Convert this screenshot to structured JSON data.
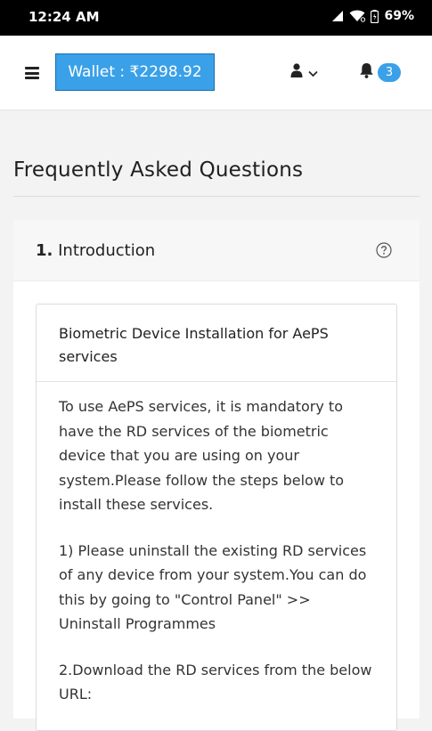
{
  "status_bar": {
    "time": "12:24 AM",
    "battery": "69%"
  },
  "navbar": {
    "wallet_label": "Wallet : ₹2298.92",
    "notification_count": "3"
  },
  "page": {
    "title": "Frequently Asked Questions"
  },
  "accordion": {
    "number": "1.",
    "title": "Introduction"
  },
  "card": {
    "heading": "Biometric Device Installation for AePS services",
    "paragraphs": [
      "To use AePS services, it is mandatory to have the RD services of the biometric device that you are using on your system.Please follow the steps below to install these services.",
      "1) Please uninstall the existing RD services of any device from your system.You can do this by going to \"Control Panel\" >> Uninstall Programmes",
      "2.Download the RD services from the below URL:"
    ]
  },
  "colors": {
    "accent": "#3aa0e8",
    "status_bar": "#000000"
  },
  "icons": [
    "signal-icon",
    "wifi-icon",
    "battery-icon",
    "menu-icon",
    "user-icon",
    "chevron-down-icon",
    "bell-icon",
    "help-circle-icon"
  ]
}
